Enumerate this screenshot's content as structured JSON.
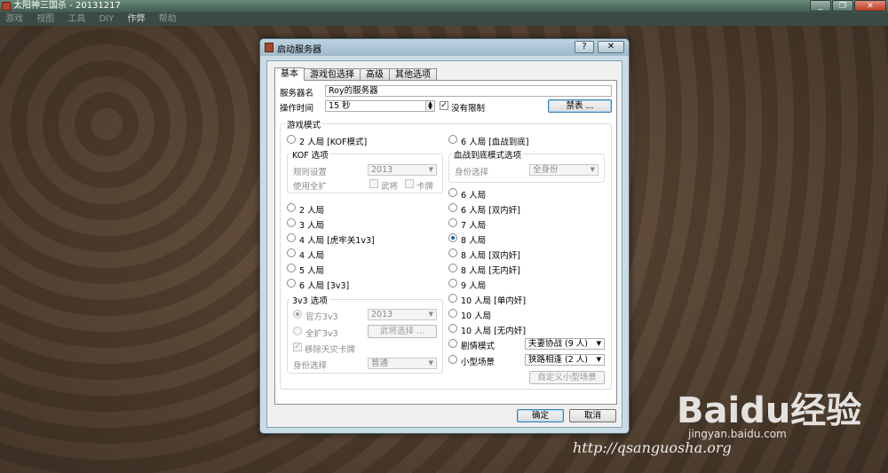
{
  "app": {
    "title": "太阳神三国杀 - 20131217",
    "menu": [
      "游戏",
      "视图",
      "工具",
      "DIY",
      "作弊",
      "帮助"
    ],
    "window_buttons": [
      "_",
      "❐",
      "✕"
    ]
  },
  "dialog": {
    "title": "启动服务器",
    "help_label": "?",
    "close_label": "✕",
    "tabs": [
      "基本",
      "游戏包选择",
      "高级",
      "其他选项"
    ],
    "server_name_label": "服务器名",
    "server_name_value": "Roy的服务器",
    "op_time_label": "操作时间",
    "op_time_value": "15 秒",
    "no_limit_label": "没有限制",
    "ban_button": "禁表 ...",
    "game_mode_label": "游戏模式",
    "left_modes": {
      "kof": "2 人局 [KOF模式]",
      "kof_options_label": "KOF 选项",
      "rule_label": "规则设置",
      "rule_value": "2013",
      "use_expansion_label": "使用全扩",
      "general_label": "武将",
      "card_label": "卡牌",
      "modes": [
        "2 人局",
        "3 人局",
        "4 人局 [虎牢关1v3]",
        "4 人局",
        "5 人局",
        "6 人局 [3v3]"
      ],
      "v3_options_label": "3v3 选项",
      "official_label": "官方3v3",
      "official_value": "2013",
      "full_label": "全扩3v3",
      "general_select": "武将选择 ...",
      "remove_disaster": "移除天灾卡牌",
      "role_select_label": "身份选择",
      "role_select_value": "普通"
    },
    "right_modes": {
      "bloody": "6 人局 [血战到底]",
      "bloody_options_label": "血战到底模式选项",
      "role_select_label": "身份选择",
      "role_select_value": "全身份",
      "modes": [
        "6 人局",
        "6 人局 [双内奸]",
        "7 人局",
        "8 人局",
        "8 人局 [双内奸]",
        "8 人局 [无内奸]",
        "9 人局",
        "10 人局 [单内奸]",
        "10 人局",
        "10 人局 [无内奸]"
      ],
      "selected_index": 3,
      "story_label": "剧情模式",
      "story_value": "夫妻协战 (9 人)",
      "mini_label": "小型场景",
      "mini_value": "狭路相逢 (2 人)",
      "custom_mini": "自定义小型场景"
    },
    "ok": "确定",
    "cancel": "取消"
  },
  "watermark": {
    "baidu": "Baidu经验",
    "baidu_url": "jingyan.baidu.com",
    "site": "http://qsanguosha.org"
  }
}
